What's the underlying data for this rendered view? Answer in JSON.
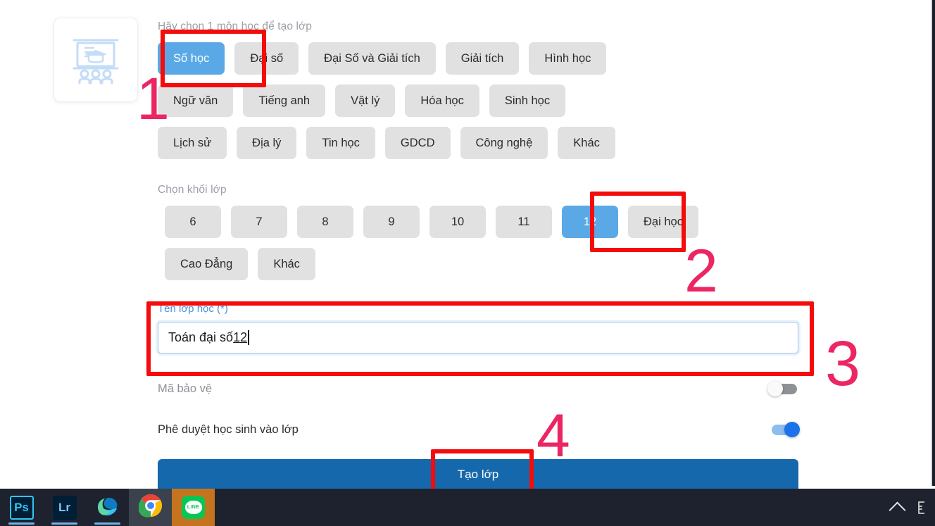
{
  "app": {
    "icon_card": {
      "icon": "classroom-presentation-icon"
    }
  },
  "subject": {
    "heading": "Hãy chọn 1 môn học để tạo lớp",
    "rows": [
      [
        {
          "label": "Số học",
          "selected": true
        },
        {
          "label": "Đại số",
          "selected": false
        },
        {
          "label": "Đại Số và Giải tích",
          "selected": false
        },
        {
          "label": "Giải tích",
          "selected": false
        },
        {
          "label": "Hình học",
          "selected": false
        }
      ],
      [
        {
          "label": "Ngữ văn",
          "selected": false
        },
        {
          "label": "Tiếng anh",
          "selected": false
        },
        {
          "label": "Vật lý",
          "selected": false
        },
        {
          "label": "Hóa học",
          "selected": false
        },
        {
          "label": "Sinh học",
          "selected": false
        }
      ],
      [
        {
          "label": "Lịch sử",
          "selected": false
        },
        {
          "label": "Địa lý",
          "selected": false
        },
        {
          "label": "Tin học",
          "selected": false
        },
        {
          "label": "GDCD",
          "selected": false
        },
        {
          "label": "Công nghệ",
          "selected": false
        },
        {
          "label": "Khác",
          "selected": false
        }
      ]
    ]
  },
  "grade": {
    "heading": "Chọn khối lớp",
    "rows": [
      [
        {
          "label": "6",
          "selected": false,
          "wide": false
        },
        {
          "label": "7",
          "selected": false,
          "wide": false
        },
        {
          "label": "8",
          "selected": false,
          "wide": false
        },
        {
          "label": "9",
          "selected": false,
          "wide": false
        },
        {
          "label": "10",
          "selected": false,
          "wide": false
        },
        {
          "label": "11",
          "selected": false,
          "wide": false
        },
        {
          "label": "12",
          "selected": true,
          "wide": false
        },
        {
          "label": "Đại học",
          "selected": false,
          "wide": true
        }
      ],
      [
        {
          "label": "Cao Đẳng",
          "selected": false,
          "wide": true
        },
        {
          "label": "Khác",
          "selected": false,
          "wide": true
        }
      ]
    ]
  },
  "class_name": {
    "label": "Tên lớp học (*)",
    "value_prefix": "Toán đại số ",
    "value_suggest": "12",
    "full_value": "Toán đại số 12",
    "placeholder": "Tên lớp học"
  },
  "options": {
    "protect_code": {
      "label": "Mã bảo vệ",
      "state": "off"
    },
    "approve_students": {
      "label": "Phê duyệt học sinh vào lớp",
      "state": "on"
    }
  },
  "submit": {
    "label": "Tạo lớp"
  },
  "annotations": {
    "step1": "1",
    "step2": "2",
    "step3": "3",
    "step4": "4",
    "box_color": "#f40b0b",
    "number_color": "#ec2663"
  },
  "taskbar": {
    "items": [
      {
        "name": "photoshop",
        "label": "Ps"
      },
      {
        "name": "lightroom",
        "label": "Lr"
      },
      {
        "name": "microsoft-edge",
        "label": ""
      },
      {
        "name": "google-chrome",
        "label": ""
      },
      {
        "name": "line",
        "label": "LINE"
      }
    ],
    "tray": {
      "chevron": "show-hidden-icons",
      "icon": "tray-icon"
    }
  },
  "colors": {
    "chip_selected": "#5aa9e6",
    "chip_default": "#e1e1e1",
    "submit": "#1668ad",
    "label_blue": "#4a90d9",
    "toggle_on": "#1a73e8"
  }
}
